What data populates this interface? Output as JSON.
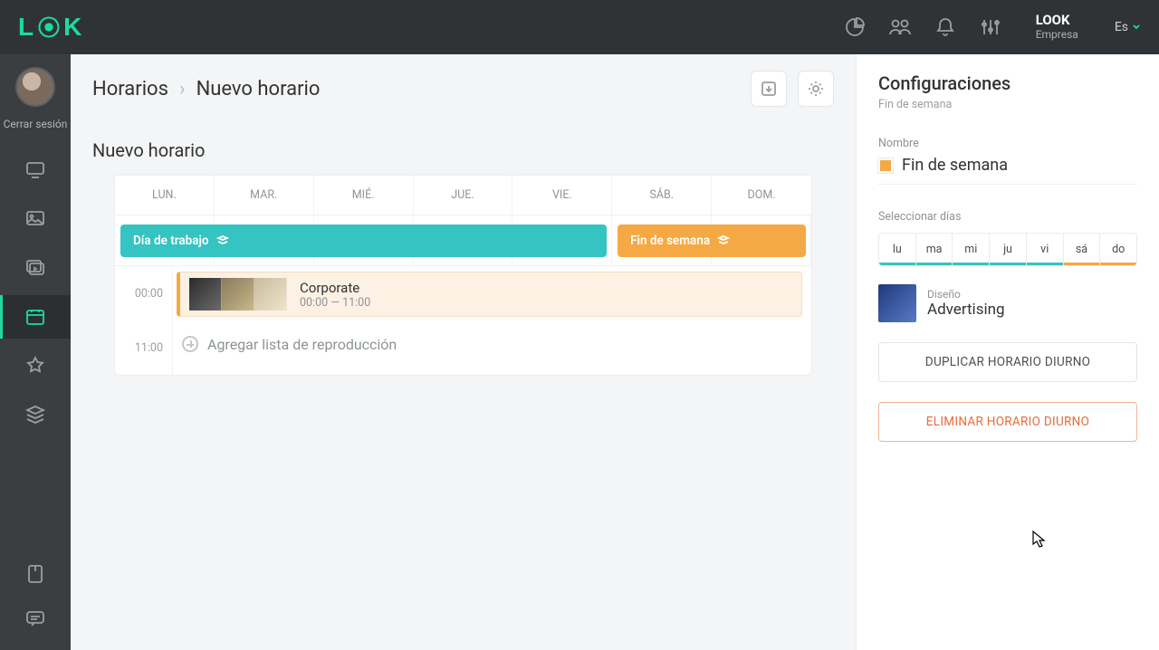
{
  "topbar": {
    "brand_name": "LOOK",
    "brand_sub": "Empresa",
    "lang": "Es"
  },
  "sidebar": {
    "logout": "Cerrar sesión"
  },
  "breadcrumbs": {
    "root": "Horarios",
    "current": "Nuevo horario"
  },
  "card": {
    "title": "Nuevo horario"
  },
  "week": {
    "days": [
      "LUN.",
      "MAR.",
      "MIÉ.",
      "JUE.",
      "VIE.",
      "SÁB.",
      "DOM."
    ]
  },
  "strips": {
    "work": "Día de trabajo",
    "weekend": "Fin de semana"
  },
  "timeline": {
    "t0": "00:00",
    "t1": "11:00",
    "item_title": "Corporate",
    "item_range": "00:00 — 11:00",
    "add_label": "Agregar lista de reproducción"
  },
  "panel": {
    "title": "Configuraciones",
    "subtitle": "Fin de semana",
    "name_label": "Nombre",
    "name_value": "Fin de semana",
    "select_days_label": "Seleccionar días",
    "day_abbr": [
      "lu",
      "ma",
      "mi",
      "ju",
      "vi",
      "sá",
      "do"
    ],
    "design_label": "Diseño",
    "design_name": "Advertising",
    "btn_duplicate": "DUPLICAR HORARIO DIURNO",
    "btn_delete": "ELIMINAR HORARIO DIURNO"
  }
}
